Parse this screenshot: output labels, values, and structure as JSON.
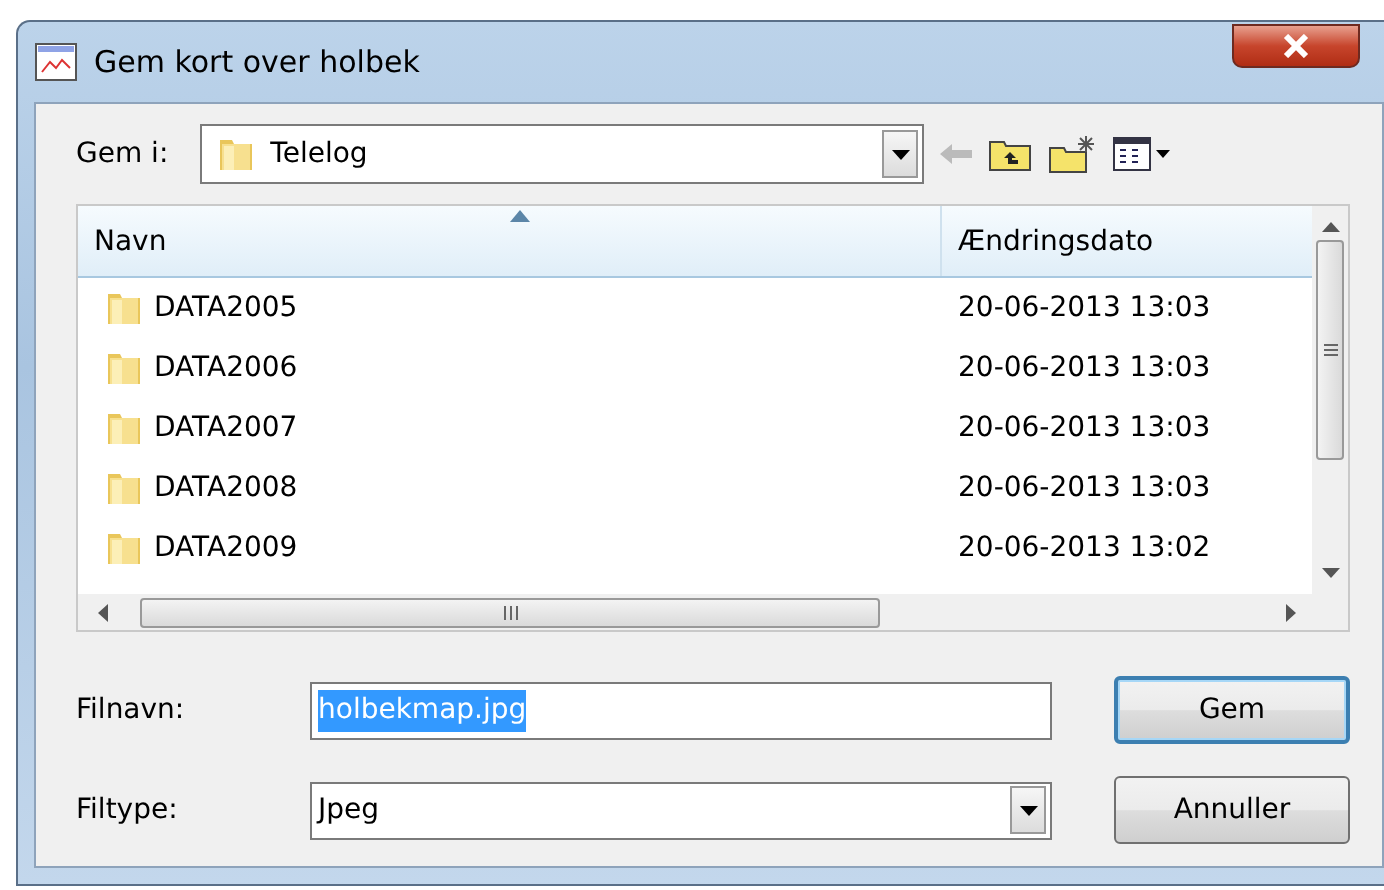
{
  "window": {
    "title": "Gem kort over holbek"
  },
  "save_in": {
    "label": "Gem i:",
    "value": "Telelog"
  },
  "file_list": {
    "columns": [
      {
        "label": "Navn",
        "sorted": true
      },
      {
        "label": "Ændringsdato",
        "sorted": false
      }
    ],
    "rows": [
      {
        "name": "DATA2005",
        "date": "20-06-2013 13:03",
        "selected": false
      },
      {
        "name": "DATA2006",
        "date": "20-06-2013 13:03",
        "selected": false
      },
      {
        "name": "DATA2007",
        "date": "20-06-2013 13:03",
        "selected": false
      },
      {
        "name": "DATA2008",
        "date": "20-06-2013 13:03",
        "selected": false
      },
      {
        "name": "DATA2009",
        "date": "20-06-2013 13:02",
        "selected": false
      }
    ]
  },
  "file_name": {
    "label": "Filnavn:",
    "value": "holbekmap.jpg",
    "text_selected": true
  },
  "file_type": {
    "label": "Filtype:",
    "value": "Jpeg"
  },
  "buttons": [
    {
      "label": "Gem",
      "default": true
    },
    {
      "label": "Annuller",
      "default": false
    }
  ]
}
